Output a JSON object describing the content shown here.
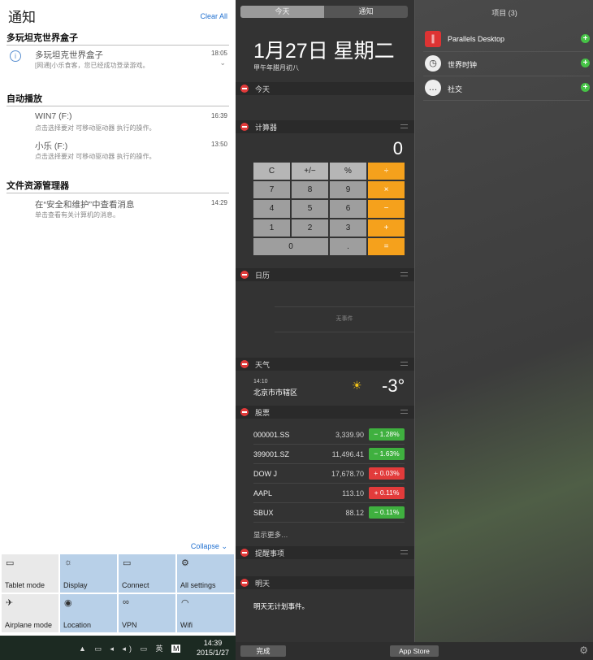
{
  "win": {
    "title": "通知",
    "clear_all": "Clear All",
    "groups": [
      {
        "name": "多玩坦克世界盒子",
        "items": [
          {
            "title": "多玩坦克世界盒子",
            "sub": "[网通]小乐食客，您已经成功登录游戏。",
            "time": "18:05",
            "icon": "info-icon"
          }
        ]
      },
      {
        "name": "自动播放",
        "items": [
          {
            "title": "WIN7 (F:)",
            "sub": "点击选择要对 可移动驱动器 执行的操作。",
            "time": "16:39"
          },
          {
            "title": "小乐 (F:)",
            "sub": "点击选择要对 可移动驱动器 执行的操作。",
            "time": "13:50"
          }
        ]
      },
      {
        "name": "文件资源管理器",
        "items": [
          {
            "title": "在“安全和维护”中查看消息",
            "sub": "单击查看有关计算机的消息。",
            "time": "14:29"
          }
        ]
      }
    ],
    "collapse": "Collapse",
    "quick_actions": [
      {
        "label": "Tablet mode",
        "icon": "tablet-icon",
        "active": false
      },
      {
        "label": "Display",
        "icon": "brightness-icon",
        "active": true
      },
      {
        "label": "Connect",
        "icon": "connect-icon",
        "active": true
      },
      {
        "label": "All settings",
        "icon": "gear-icon",
        "active": true
      },
      {
        "label": "Airplane mode",
        "icon": "airplane-icon",
        "active": false
      },
      {
        "label": "Location",
        "icon": "location-icon",
        "active": true
      },
      {
        "label": "VPN",
        "icon": "vpn-icon",
        "active": true
      },
      {
        "label": "Wifi",
        "icon": "wifi-icon",
        "active": true
      }
    ],
    "taskbar": {
      "tray_text": "英",
      "ime": "M",
      "time": "14:39",
      "date": "2015/1/27"
    }
  },
  "mac": {
    "tabs": [
      "今天",
      "通知"
    ],
    "date": "1月27日 星期二",
    "lunar": "甲午年腊月初八",
    "sections": {
      "today": "今天",
      "calculator": "计算器",
      "calendar": "日历",
      "weather": "天气",
      "stocks": "股票",
      "reminders": "提醒事项",
      "tomorrow": "明天"
    },
    "calc_display": "0",
    "calc_keys": [
      "C",
      "+/−",
      "%",
      "÷",
      "7",
      "8",
      "9",
      "×",
      "4",
      "5",
      "6",
      "−",
      "1",
      "2",
      "3",
      "+",
      "0",
      ".",
      "="
    ],
    "calendar_empty": "无事件",
    "weather": {
      "time": "14:10",
      "city": "北京市市辖区",
      "temp": "-3°",
      "icon": "sun-icon"
    },
    "stocks": [
      {
        "symbol": "000001.SS",
        "price": "3,339.90",
        "change": "− 1.28%",
        "dir": "down"
      },
      {
        "symbol": "399001.SZ",
        "price": "11,496.41",
        "change": "− 1.63%",
        "dir": "down"
      },
      {
        "symbol": "DOW J",
        "price": "17,678.70",
        "change": "+ 0.03%",
        "dir": "up"
      },
      {
        "symbol": "AAPL",
        "price": "113.10",
        "change": "+ 0.11%",
        "dir": "up"
      },
      {
        "symbol": "SBUX",
        "price": "88.12",
        "change": "− 0.11%",
        "dir": "down"
      }
    ],
    "show_more": "显示更多…",
    "tomorrow_text": "明天无计划事件。",
    "done": "完成",
    "app_store": "App Store"
  },
  "items_panel": {
    "title": "项目 (3)",
    "items": [
      {
        "label": "Parallels Desktop",
        "icon": "parallels-icon"
      },
      {
        "label": "世界时钟",
        "icon": "clock-icon"
      },
      {
        "label": "社交",
        "icon": "chat-icon"
      }
    ]
  }
}
